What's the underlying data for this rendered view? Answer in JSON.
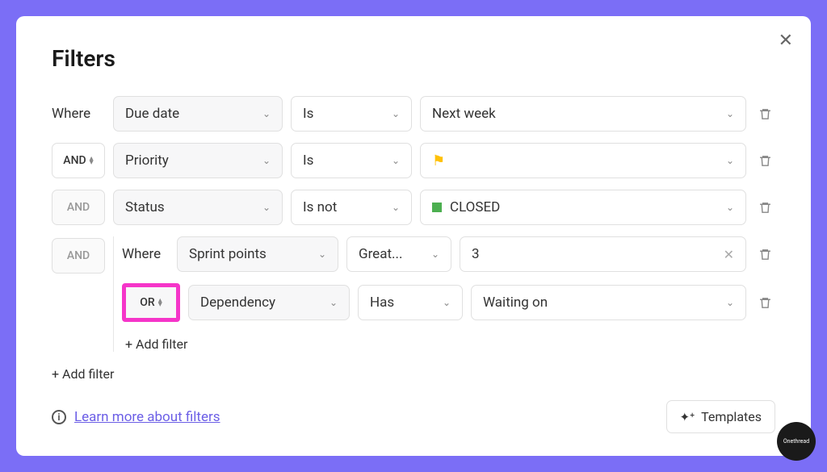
{
  "title": "Filters",
  "where_label": "Where",
  "operators": {
    "and": "AND",
    "or": "OR"
  },
  "rows": [
    {
      "field": "Due date",
      "condition": "Is",
      "value": "Next week"
    },
    {
      "field": "Priority",
      "condition": "Is",
      "value_type": "flag"
    },
    {
      "field": "Status",
      "condition": "Is not",
      "value": "CLOSED",
      "value_type": "status"
    }
  ],
  "nested": {
    "where_label": "Where",
    "rows": [
      {
        "field": "Sprint points",
        "condition": "Great...",
        "value": "3",
        "clearable": true
      },
      {
        "field": "Dependency",
        "condition": "Has",
        "value": "Waiting on"
      }
    ]
  },
  "add_filter_label": "+ Add filter",
  "learn_more": "Learn more about filters",
  "templates_label": "Templates",
  "brand": "Onethread"
}
